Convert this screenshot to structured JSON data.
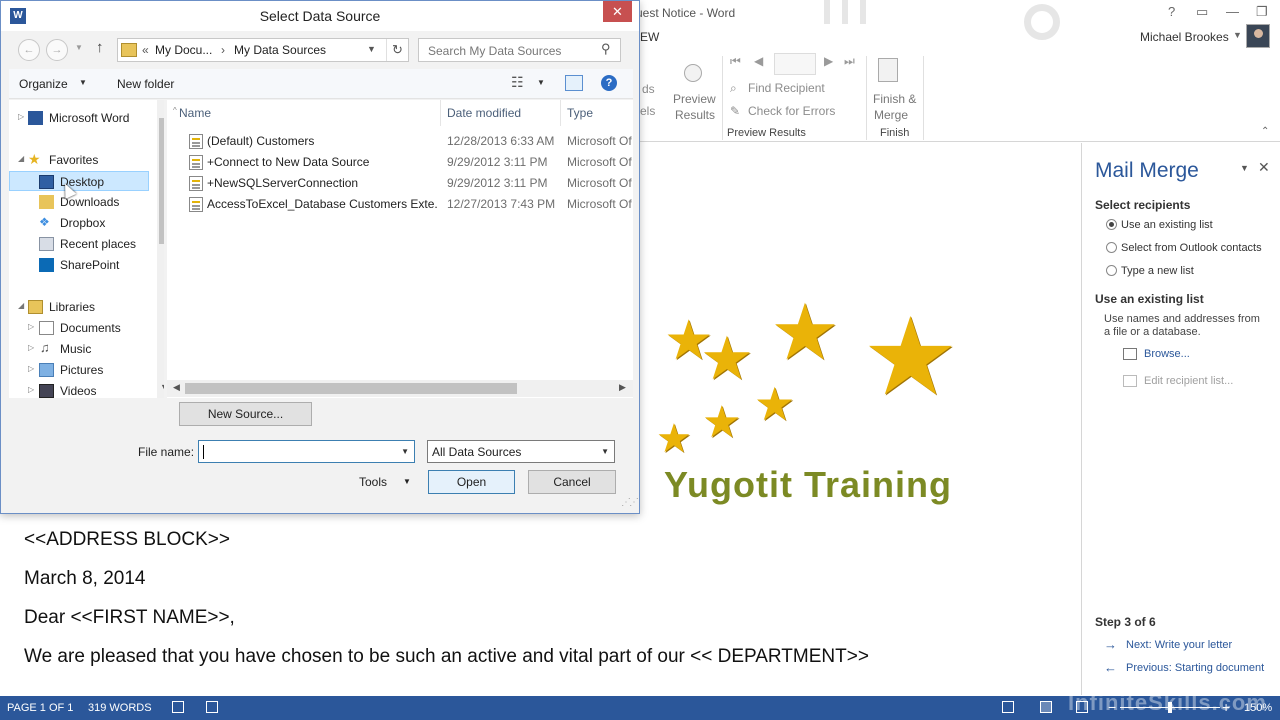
{
  "word": {
    "window_title": "uest Notice - Word",
    "ribbon_tab_partial": "EW",
    "user_name": "Michael Brookes",
    "ribbon": {
      "partial_label_1": "ds",
      "partial_label_2": "els",
      "preview_results_l1": "Preview",
      "preview_results_l2": "Results",
      "find_recipient": "Find Recipient",
      "check_for_errors": "Check for Errors",
      "group_preview_results": "Preview Results",
      "finish_merge_l1": "Finish &",
      "finish_merge_l2": "Merge",
      "group_finish": "Finish"
    },
    "document": {
      "line1": "<<ADDRESS BLOCK>>",
      "line2": "March 8, 2014",
      "line3": "Dear <<FIRST NAME>>,",
      "line4": "We are pleased that you have chosen to be such an active and vital part of our  << DEPARTMENT>>",
      "logo_text": "Yugotit Training"
    },
    "mail_merge": {
      "title": "Mail Merge",
      "select_recipients_heading": "Select recipients",
      "options": [
        {
          "label": "Use an existing list",
          "selected": true
        },
        {
          "label": "Select from Outlook contacts",
          "selected": false
        },
        {
          "label": "Type a new list",
          "selected": false
        }
      ],
      "existing_list_heading": "Use an existing list",
      "existing_list_desc": "Use names and addresses from a file or a database.",
      "browse_link": "Browse...",
      "edit_recipient_link": "Edit recipient list...",
      "step_label": "Step 3 of 6",
      "next_link": "Next: Write your letter",
      "previous_link": "Previous: Starting document"
    },
    "status_bar": {
      "page": "PAGE 1 OF 1",
      "words": "319 WORDS",
      "zoom": "150%",
      "watermark": "InfiniteSkills.com"
    }
  },
  "dialog": {
    "title": "Select Data Source",
    "app_icon_letter": "W",
    "address": {
      "ellipsis": "«",
      "part1": "My Docu...",
      "sep": "›",
      "part2": "My Data Sources"
    },
    "search_placeholder": "Search My Data Sources",
    "toolbar": {
      "organize": "Organize",
      "new_folder": "New folder"
    },
    "nav_items": [
      {
        "label": "Microsoft Word",
        "icon": "word-icon",
        "expander": "▷"
      },
      {
        "label": "Favorites",
        "icon": "star-icon",
        "expander": "◢"
      },
      {
        "label": "Desktop",
        "icon": "desktop-icon",
        "expander": "",
        "selected": true
      },
      {
        "label": "Downloads",
        "icon": "downloads-icon",
        "expander": ""
      },
      {
        "label": "Dropbox",
        "icon": "dropbox-icon",
        "expander": ""
      },
      {
        "label": "Recent places",
        "icon": "recent-places-icon",
        "expander": ""
      },
      {
        "label": "SharePoint",
        "icon": "sharepoint-icon",
        "expander": ""
      },
      {
        "label": "Libraries",
        "icon": "libraries-icon",
        "expander": "◢"
      },
      {
        "label": "Documents",
        "icon": "documents-icon",
        "expander": "▷"
      },
      {
        "label": "Music",
        "icon": "music-icon",
        "expander": "▷"
      },
      {
        "label": "Pictures",
        "icon": "pictures-icon",
        "expander": "▷"
      },
      {
        "label": "Videos",
        "icon": "videos-icon",
        "expander": "▷"
      }
    ],
    "columns": {
      "name": "Name",
      "date_modified": "Date modified",
      "type": "Type"
    },
    "files": [
      {
        "name": "(Default) Customers",
        "date": "12/28/2013 6:33 AM",
        "type": "Microsoft Of"
      },
      {
        "name": "+Connect to New Data Source",
        "date": "9/29/2012 3:11 PM",
        "type": "Microsoft Of"
      },
      {
        "name": "+NewSQLServerConnection",
        "date": "9/29/2012 3:11 PM",
        "type": "Microsoft Of"
      },
      {
        "name": "AccessToExcel_Database Customers Exte...",
        "date": "12/27/2013 7:43 PM",
        "type": "Microsoft Of"
      }
    ],
    "new_source_button": "New Source...",
    "file_name_label": "File name:",
    "file_name_value": "",
    "file_type_value": "All Data Sources",
    "tools_label": "Tools",
    "open_button": "Open",
    "cancel_button": "Cancel"
  },
  "colors": {
    "word_blue": "#2b579a",
    "selection_blue": "#cce8ff",
    "star_gold": "#eab308",
    "logo_green": "#7c8a24"
  }
}
